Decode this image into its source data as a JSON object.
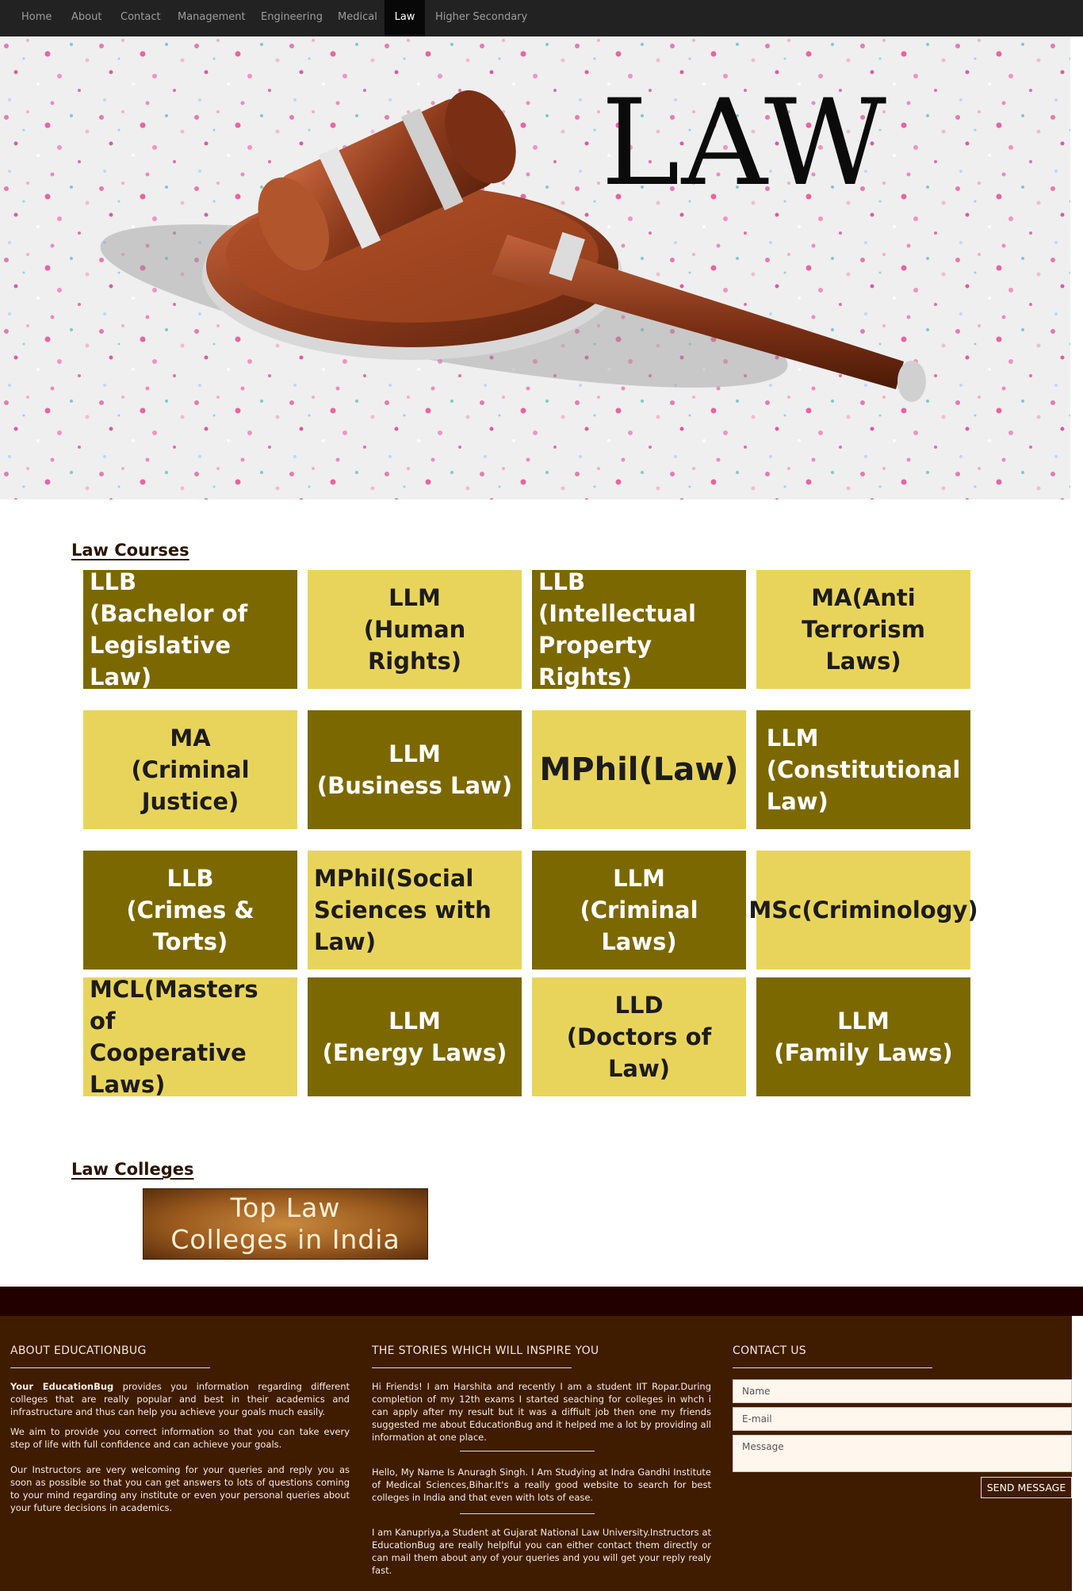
{
  "nav": {
    "items": [
      {
        "label": "Home",
        "active": false
      },
      {
        "label": "About",
        "active": false
      },
      {
        "label": "Contact",
        "active": false
      },
      {
        "label": "Management",
        "active": false
      },
      {
        "label": "Engineering",
        "active": false
      },
      {
        "label": "Medical",
        "active": false
      },
      {
        "label": "Law",
        "active": true
      },
      {
        "label": "Higher Secondary",
        "active": false
      }
    ]
  },
  "hero": {
    "title": "LAW",
    "image": "gavel-icon"
  },
  "courses": {
    "heading": "Law Courses",
    "tiles": [
      {
        "text": "LLB\n(Bachelor of\nLegislative Law)",
        "style": "dark"
      },
      {
        "text": "LLM\n(Human Rights)",
        "style": "light"
      },
      {
        "text": "LLB\n(Intellectual\nProperty Rights)",
        "style": "dark"
      },
      {
        "text": "MA(Anti\nTerrorism Laws)",
        "style": "light"
      },
      {
        "text": "MA\n(Criminal Justice)",
        "style": "light"
      },
      {
        "text": "LLM\n(Business Law)",
        "style": "dark"
      },
      {
        "text": "MPhil(Law)",
        "style": "light"
      },
      {
        "text": "LLM\n(Constitutional\nLaw)",
        "style": "dark"
      },
      {
        "text": "LLB\n(Crimes & Torts)",
        "style": "dark"
      },
      {
        "text": "MPhil(Social\nSciences with Law)",
        "style": "light"
      },
      {
        "text": "LLM\n(Criminal Laws)",
        "style": "dark"
      },
      {
        "text": "MSc(Criminology)",
        "style": "light"
      },
      {
        "text": "MCL(Masters of\nCooperative Laws)",
        "style": "light"
      },
      {
        "text": "LLM\n(Energy Laws)",
        "style": "dark"
      },
      {
        "text": "LLD\n(Doctors of Law)",
        "style": "light"
      },
      {
        "text": "LLM\n(Family Laws)",
        "style": "dark"
      }
    ]
  },
  "colleges": {
    "heading": "Law Colleges",
    "banner_text": "Top Law\nColleges in India"
  },
  "footer": {
    "about": {
      "heading": "ABOUT EDUCATIONBUG",
      "brand": "Your EducationBug",
      "para1_rest": " provides you information regarding different colleges that are really popular and best in their academics and infrastructure and thus can help you achieve your goals much easily.",
      "para2": "We aim to provide you correct information so that you can take every step of life with full confidence and can achieve your goals.",
      "para3": "Our Instructors are very welcoming for your queries and reply you as soon as possible so that you can get answers to lots of questions coming to your mind regarding any institute or even your personal queries about your future decisions in academics."
    },
    "stories": {
      "heading": "THE STORIES WHICH WILL INSPIRE YOU",
      "story1": "Hi Friends! I am Harshita and recently I am a student IIT Ropar.During completion of my 12th exams I started seaching for colleges in whch i can apply after my result but it was a diffiult job then one my friends suggested me about EducationBug and it helped me a lot by providing all information at one place.",
      "story2": "Hello, My Name Is Anuragh Singh. I Am Studying at Indra Gandhi Institute of Medical Sciences,Bihar.It's a really good website to search for best colleges in India and that even with lots of ease.",
      "story3": "I am Kanupriya,a Student at Gujarat National Law University.Instructors at EducationBug are really helplful you can either contact them directly or can mail them about any of your queries and you will get your reply realy fast."
    },
    "contact": {
      "heading": "CONTACT US",
      "name_placeholder": "Name",
      "email_placeholder": "E-mail",
      "message_placeholder": "Message",
      "button_label": "SEND MESSAGE"
    }
  },
  "colors": {
    "nav_bg": "#222222",
    "tile_dark": "#7c6800",
    "tile_light": "#e9d45b",
    "footer_bg": "#3f1b00",
    "footer_top": "#230000"
  }
}
